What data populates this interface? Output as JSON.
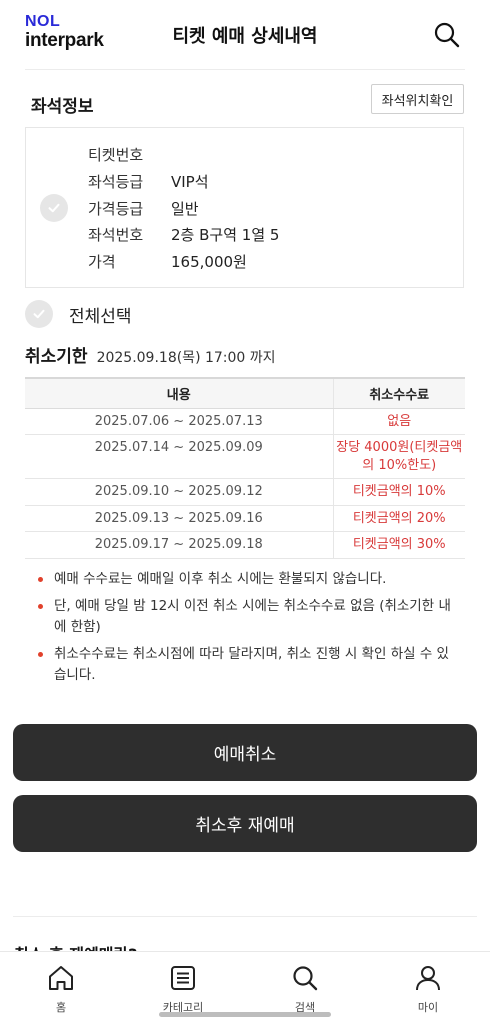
{
  "header": {
    "logo_top": "NOL",
    "logo_bottom": "interpark",
    "title": "티켓 예매 상세내역",
    "search_icon": "search-icon"
  },
  "seat_info": {
    "title": "좌석정보",
    "location_button": "좌석위치확인",
    "rows": [
      {
        "label": "티켓번호",
        "value": ""
      },
      {
        "label": "좌석등급",
        "value": "VIP석"
      },
      {
        "label": "가격등급",
        "value": "일반"
      },
      {
        "label": "좌석번호",
        "value": "2층 B구역 1열 5"
      },
      {
        "label": "가격",
        "value": "165,000원"
      }
    ]
  },
  "select_all": {
    "label": "전체선택"
  },
  "deadline": {
    "title": "취소기한",
    "date": "2025.09.18(목) 17:00 까지"
  },
  "fee_table": {
    "headers": [
      "내용",
      "취소수수료"
    ],
    "rows": [
      {
        "period": "2025.07.06 ~ 2025.07.13",
        "fee": "없음"
      },
      {
        "period": "2025.07.14 ~ 2025.09.09",
        "fee": "장당 4000원(티켓금액의 10%한도)"
      },
      {
        "period": "2025.09.10 ~ 2025.09.12",
        "fee": "티켓금액의 10%"
      },
      {
        "period": "2025.09.13 ~ 2025.09.16",
        "fee": "티켓금액의 20%"
      },
      {
        "period": "2025.09.17 ~ 2025.09.18",
        "fee": "티켓금액의 30%"
      }
    ]
  },
  "notes": [
    "예매 수수료는 예매일 이후 취소 시에는 환불되지 않습니다.",
    "단, 예매 당일 밤 12시 이전 취소 시에는 취소수수료 없음 (취소기한 내에 한함)",
    "취소수수료는 취소시점에 따라 달라지며, 취소 진행 시 확인 하실 수 있습니다."
  ],
  "buttons": {
    "cancel": "예매취소",
    "rebook": "취소후 재예매"
  },
  "faq_title": "취소 후 재예매란?",
  "tabbar": [
    {
      "label": "홈",
      "icon": "home-icon"
    },
    {
      "label": "카테고리",
      "icon": "list-icon"
    },
    {
      "label": "검색",
      "icon": "search-icon"
    },
    {
      "label": "마이",
      "icon": "person-icon"
    }
  ],
  "colors": {
    "accent_red": "#d83a3a",
    "button_dark": "#2e2e2e",
    "logo_blue": "#2a2ad8"
  }
}
